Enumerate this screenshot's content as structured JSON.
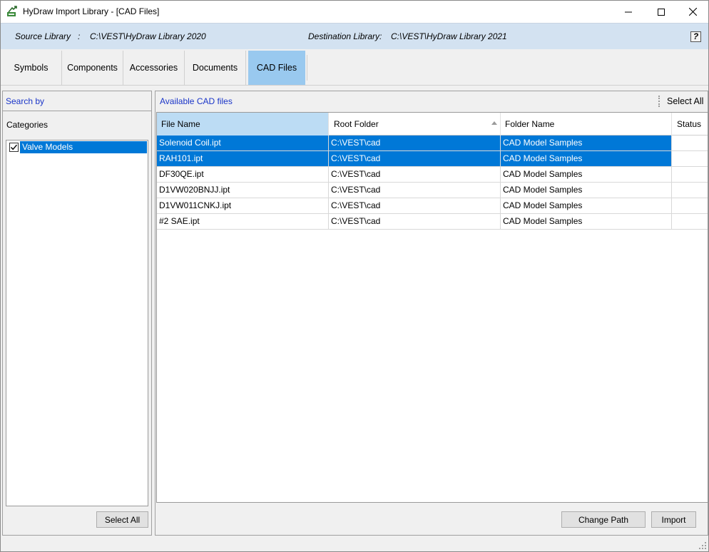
{
  "window": {
    "title": "HyDraw Import Library - [CAD Files]"
  },
  "library": {
    "source_label": "Source Library",
    "source_sep": ":",
    "source_path": "C:\\VEST\\HyDraw Library 2020",
    "dest_label": "Destination Library",
    "dest_sep": ":",
    "dest_path": "C:\\VEST\\HyDraw Library 2021",
    "help": "?"
  },
  "tabs": [
    {
      "label": "Symbols"
    },
    {
      "label": "Components"
    },
    {
      "label": "Accessories"
    },
    {
      "label": "Documents"
    },
    {
      "label": "CAD Files",
      "active": true
    }
  ],
  "left": {
    "search_by": "Search by",
    "categories_label": "Categories",
    "categories": [
      {
        "label": "Valve Models",
        "checked": true
      }
    ],
    "select_all": "Select All"
  },
  "right": {
    "header": "Available CAD files",
    "select_all": "Select All",
    "columns": [
      "File Name",
      "Root Folder",
      "Folder Name",
      "Status"
    ],
    "rows": [
      {
        "file": "Solenoid Coil.ipt",
        "root": "C:\\VEST\\cad",
        "folder": "CAD Model Samples",
        "status": "",
        "selected": true
      },
      {
        "file": "RAH101.ipt",
        "root": "C:\\VEST\\cad",
        "folder": "CAD Model Samples",
        "status": "",
        "selected": true
      },
      {
        "file": "DF30QE.ipt",
        "root": "C:\\VEST\\cad",
        "folder": "CAD Model Samples",
        "status": ""
      },
      {
        "file": "D1VW020BNJJ.ipt",
        "root": "C:\\VEST\\cad",
        "folder": "CAD Model Samples",
        "status": ""
      },
      {
        "file": "D1VW011CNKJ.ipt",
        "root": "C:\\VEST\\cad",
        "folder": "CAD Model Samples",
        "status": ""
      },
      {
        "file": "#2 SAE.ipt",
        "root": "C:\\VEST\\cad",
        "folder": "CAD Model Samples",
        "status": ""
      }
    ],
    "change_path": "Change Path",
    "import": "Import"
  },
  "colors": {
    "accent": "#0078d7",
    "tab_active": "#99c9ef",
    "header_band": "#d3e2f1",
    "link_blue": "#1a35c8"
  }
}
